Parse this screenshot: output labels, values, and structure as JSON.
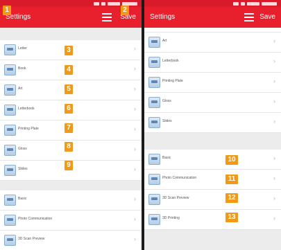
{
  "left_screen": {
    "appbar": {
      "title": "Settings",
      "save_label": "Save"
    },
    "group1": [
      {
        "label": "Letter",
        "badge": "3"
      },
      {
        "label": "Book",
        "badge": "4"
      },
      {
        "label": "Art",
        "badge": "5"
      },
      {
        "label": "Letterbook",
        "badge": "6"
      },
      {
        "label": "Printing Plate",
        "badge": "7"
      },
      {
        "label": "Gloss",
        "badge": "8"
      },
      {
        "label": "Slides",
        "badge": "9"
      }
    ],
    "group2": [
      {
        "label": "Basic"
      },
      {
        "label": "Photo Communication"
      },
      {
        "label": "3D Scan Preview"
      }
    ]
  },
  "right_screen": {
    "appbar": {
      "title": "Settings",
      "save_label": "Save"
    },
    "group1": [
      {
        "label": "Art"
      },
      {
        "label": "Letterbook"
      },
      {
        "label": "Printing Plate"
      },
      {
        "label": "Gloss"
      },
      {
        "label": "Slides"
      }
    ],
    "group2": [
      {
        "label": "Basic",
        "badge": "10"
      },
      {
        "label": "Photo Communication",
        "badge": "11"
      },
      {
        "label": "3D Scan Preview",
        "badge": "12"
      },
      {
        "label": "3D Printing",
        "badge": "13"
      }
    ]
  },
  "annotations": {
    "badge_1": "1",
    "badge_2": "2"
  },
  "icons": {
    "row_icon": "document-icon",
    "chevron": "chevron-right-icon",
    "menu": "menu-icon"
  },
  "colors": {
    "appbar": "#e8202e",
    "statusbar": "#d91a2a",
    "badge": "#f29a17",
    "background": "#ececec"
  }
}
